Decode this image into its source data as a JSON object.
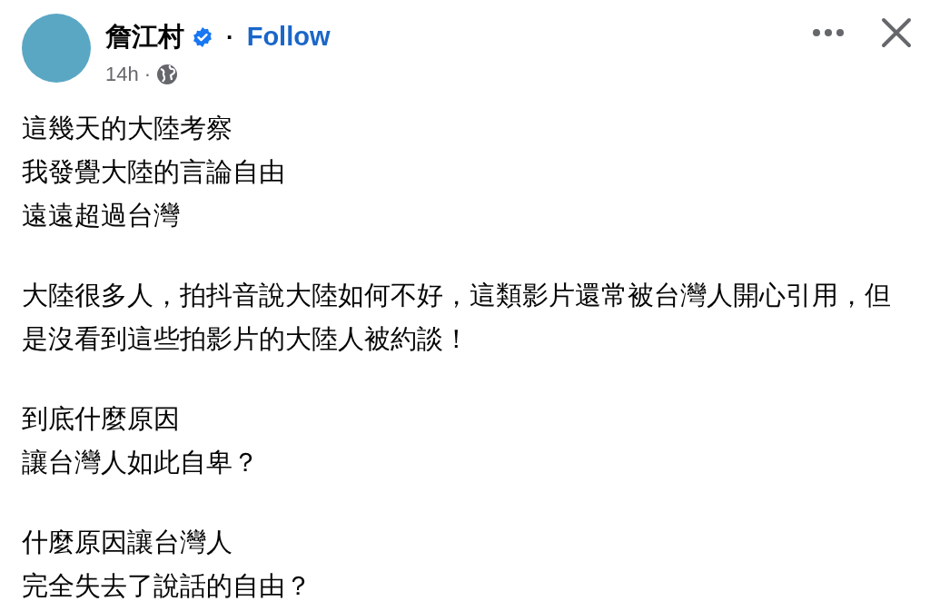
{
  "author": {
    "name": "詹江村",
    "verified": true,
    "separator": "·",
    "follow": "Follow",
    "time": "14h",
    "time_separator": "·"
  },
  "paragraphs": [
    [
      "這幾天的大陸考察",
      "我發覺大陸的言論自由",
      "遠遠超過台灣"
    ],
    [
      "大陸很多人，拍抖音說大陸如何不好，這類影片還常被台灣人開心引用，但是沒看到這些拍影片的大陸人被約談！"
    ],
    [
      "到底什麼原因",
      "讓台灣人如此自卑？"
    ],
    [
      "什麼原因讓台灣人",
      "完全失去了說話的自由？"
    ]
  ]
}
